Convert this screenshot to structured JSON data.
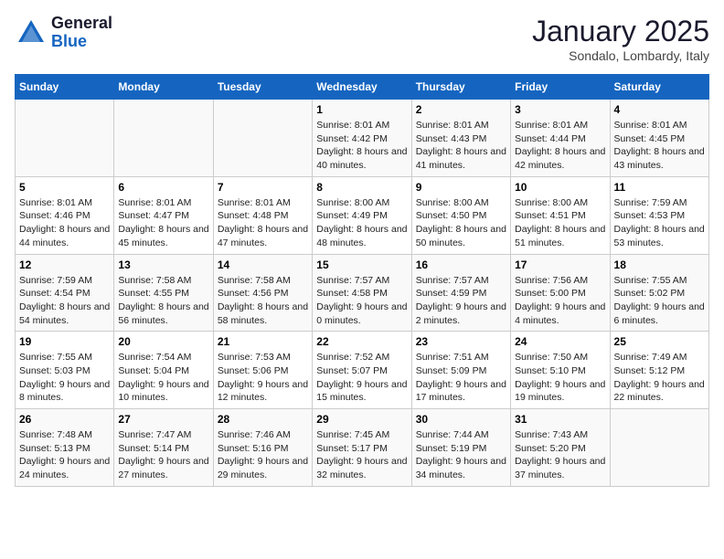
{
  "header": {
    "logo_line1": "General",
    "logo_line2": "Blue",
    "month": "January 2025",
    "location": "Sondalo, Lombardy, Italy"
  },
  "days_of_week": [
    "Sunday",
    "Monday",
    "Tuesday",
    "Wednesday",
    "Thursday",
    "Friday",
    "Saturday"
  ],
  "weeks": [
    [
      {
        "day": "",
        "info": ""
      },
      {
        "day": "",
        "info": ""
      },
      {
        "day": "",
        "info": ""
      },
      {
        "day": "1",
        "info": "Sunrise: 8:01 AM\nSunset: 4:42 PM\nDaylight: 8 hours and 40 minutes."
      },
      {
        "day": "2",
        "info": "Sunrise: 8:01 AM\nSunset: 4:43 PM\nDaylight: 8 hours and 41 minutes."
      },
      {
        "day": "3",
        "info": "Sunrise: 8:01 AM\nSunset: 4:44 PM\nDaylight: 8 hours and 42 minutes."
      },
      {
        "day": "4",
        "info": "Sunrise: 8:01 AM\nSunset: 4:45 PM\nDaylight: 8 hours and 43 minutes."
      }
    ],
    [
      {
        "day": "5",
        "info": "Sunrise: 8:01 AM\nSunset: 4:46 PM\nDaylight: 8 hours and 44 minutes."
      },
      {
        "day": "6",
        "info": "Sunrise: 8:01 AM\nSunset: 4:47 PM\nDaylight: 8 hours and 45 minutes."
      },
      {
        "day": "7",
        "info": "Sunrise: 8:01 AM\nSunset: 4:48 PM\nDaylight: 8 hours and 47 minutes."
      },
      {
        "day": "8",
        "info": "Sunrise: 8:00 AM\nSunset: 4:49 PM\nDaylight: 8 hours and 48 minutes."
      },
      {
        "day": "9",
        "info": "Sunrise: 8:00 AM\nSunset: 4:50 PM\nDaylight: 8 hours and 50 minutes."
      },
      {
        "day": "10",
        "info": "Sunrise: 8:00 AM\nSunset: 4:51 PM\nDaylight: 8 hours and 51 minutes."
      },
      {
        "day": "11",
        "info": "Sunrise: 7:59 AM\nSunset: 4:53 PM\nDaylight: 8 hours and 53 minutes."
      }
    ],
    [
      {
        "day": "12",
        "info": "Sunrise: 7:59 AM\nSunset: 4:54 PM\nDaylight: 8 hours and 54 minutes."
      },
      {
        "day": "13",
        "info": "Sunrise: 7:58 AM\nSunset: 4:55 PM\nDaylight: 8 hours and 56 minutes."
      },
      {
        "day": "14",
        "info": "Sunrise: 7:58 AM\nSunset: 4:56 PM\nDaylight: 8 hours and 58 minutes."
      },
      {
        "day": "15",
        "info": "Sunrise: 7:57 AM\nSunset: 4:58 PM\nDaylight: 9 hours and 0 minutes."
      },
      {
        "day": "16",
        "info": "Sunrise: 7:57 AM\nSunset: 4:59 PM\nDaylight: 9 hours and 2 minutes."
      },
      {
        "day": "17",
        "info": "Sunrise: 7:56 AM\nSunset: 5:00 PM\nDaylight: 9 hours and 4 minutes."
      },
      {
        "day": "18",
        "info": "Sunrise: 7:55 AM\nSunset: 5:02 PM\nDaylight: 9 hours and 6 minutes."
      }
    ],
    [
      {
        "day": "19",
        "info": "Sunrise: 7:55 AM\nSunset: 5:03 PM\nDaylight: 9 hours and 8 minutes."
      },
      {
        "day": "20",
        "info": "Sunrise: 7:54 AM\nSunset: 5:04 PM\nDaylight: 9 hours and 10 minutes."
      },
      {
        "day": "21",
        "info": "Sunrise: 7:53 AM\nSunset: 5:06 PM\nDaylight: 9 hours and 12 minutes."
      },
      {
        "day": "22",
        "info": "Sunrise: 7:52 AM\nSunset: 5:07 PM\nDaylight: 9 hours and 15 minutes."
      },
      {
        "day": "23",
        "info": "Sunrise: 7:51 AM\nSunset: 5:09 PM\nDaylight: 9 hours and 17 minutes."
      },
      {
        "day": "24",
        "info": "Sunrise: 7:50 AM\nSunset: 5:10 PM\nDaylight: 9 hours and 19 minutes."
      },
      {
        "day": "25",
        "info": "Sunrise: 7:49 AM\nSunset: 5:12 PM\nDaylight: 9 hours and 22 minutes."
      }
    ],
    [
      {
        "day": "26",
        "info": "Sunrise: 7:48 AM\nSunset: 5:13 PM\nDaylight: 9 hours and 24 minutes."
      },
      {
        "day": "27",
        "info": "Sunrise: 7:47 AM\nSunset: 5:14 PM\nDaylight: 9 hours and 27 minutes."
      },
      {
        "day": "28",
        "info": "Sunrise: 7:46 AM\nSunset: 5:16 PM\nDaylight: 9 hours and 29 minutes."
      },
      {
        "day": "29",
        "info": "Sunrise: 7:45 AM\nSunset: 5:17 PM\nDaylight: 9 hours and 32 minutes."
      },
      {
        "day": "30",
        "info": "Sunrise: 7:44 AM\nSunset: 5:19 PM\nDaylight: 9 hours and 34 minutes."
      },
      {
        "day": "31",
        "info": "Sunrise: 7:43 AM\nSunset: 5:20 PM\nDaylight: 9 hours and 37 minutes."
      },
      {
        "day": "",
        "info": ""
      }
    ]
  ]
}
